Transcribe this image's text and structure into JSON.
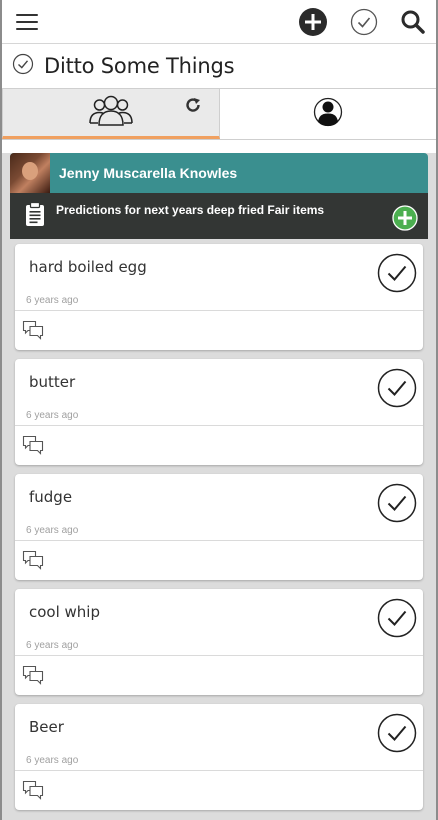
{
  "header": {
    "menu_icon": "hamburger-icon",
    "add_icon": "plus-circle-icon",
    "done_icon": "check-circle-icon",
    "search_icon": "search-icon"
  },
  "title": {
    "text": "Ditto Some Things",
    "icon": "check-circle-icon"
  },
  "tabs": [
    {
      "name": "group",
      "icon": "people-icon",
      "active": true,
      "extra_icon": "refresh-icon"
    },
    {
      "name": "personal",
      "icon": "person-icon",
      "active": false
    }
  ],
  "user": {
    "name": "Jenny Muscarella Knowles",
    "avatar": "avatar-photo"
  },
  "list": {
    "title": "Predictions for next years deep fried Fair items",
    "icon": "clipboard-icon",
    "add_icon": "plus-circle-green-icon"
  },
  "items": [
    {
      "name": "hard boiled egg",
      "time": "6 years ago"
    },
    {
      "name": "butter",
      "time": "6 years ago"
    },
    {
      "name": "fudge",
      "time": "6 years ago"
    },
    {
      "name": "cool whip",
      "time": "6 years ago"
    },
    {
      "name": "Beer",
      "time": "6 years ago"
    }
  ],
  "colors": {
    "teal": "#3a8f8f",
    "dark_header": "#333634",
    "tab_accent": "#f0a060",
    "add_green": "#4caf50"
  }
}
